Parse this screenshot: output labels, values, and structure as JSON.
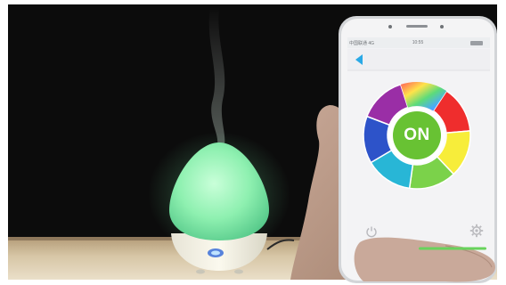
{
  "app": {
    "status_left": "中国联通 4G",
    "status_time": "10:55",
    "title": "",
    "power_label": "ON"
  },
  "color_wheel": {
    "segments": [
      "#ef2d2d",
      "#f7ed3a",
      "#7bd24a",
      "#28b6d6",
      "#2d53c9",
      "#9a2ea6"
    ],
    "center_color": "#68c233"
  },
  "icons": {
    "back": "back-arrow-icon",
    "power": "power-icon",
    "settings": "gear-icon"
  },
  "colors": {
    "diffuser_glow": "#8ef0b0",
    "app_accent": "#2aa9e6",
    "slider": "#68d35c"
  }
}
